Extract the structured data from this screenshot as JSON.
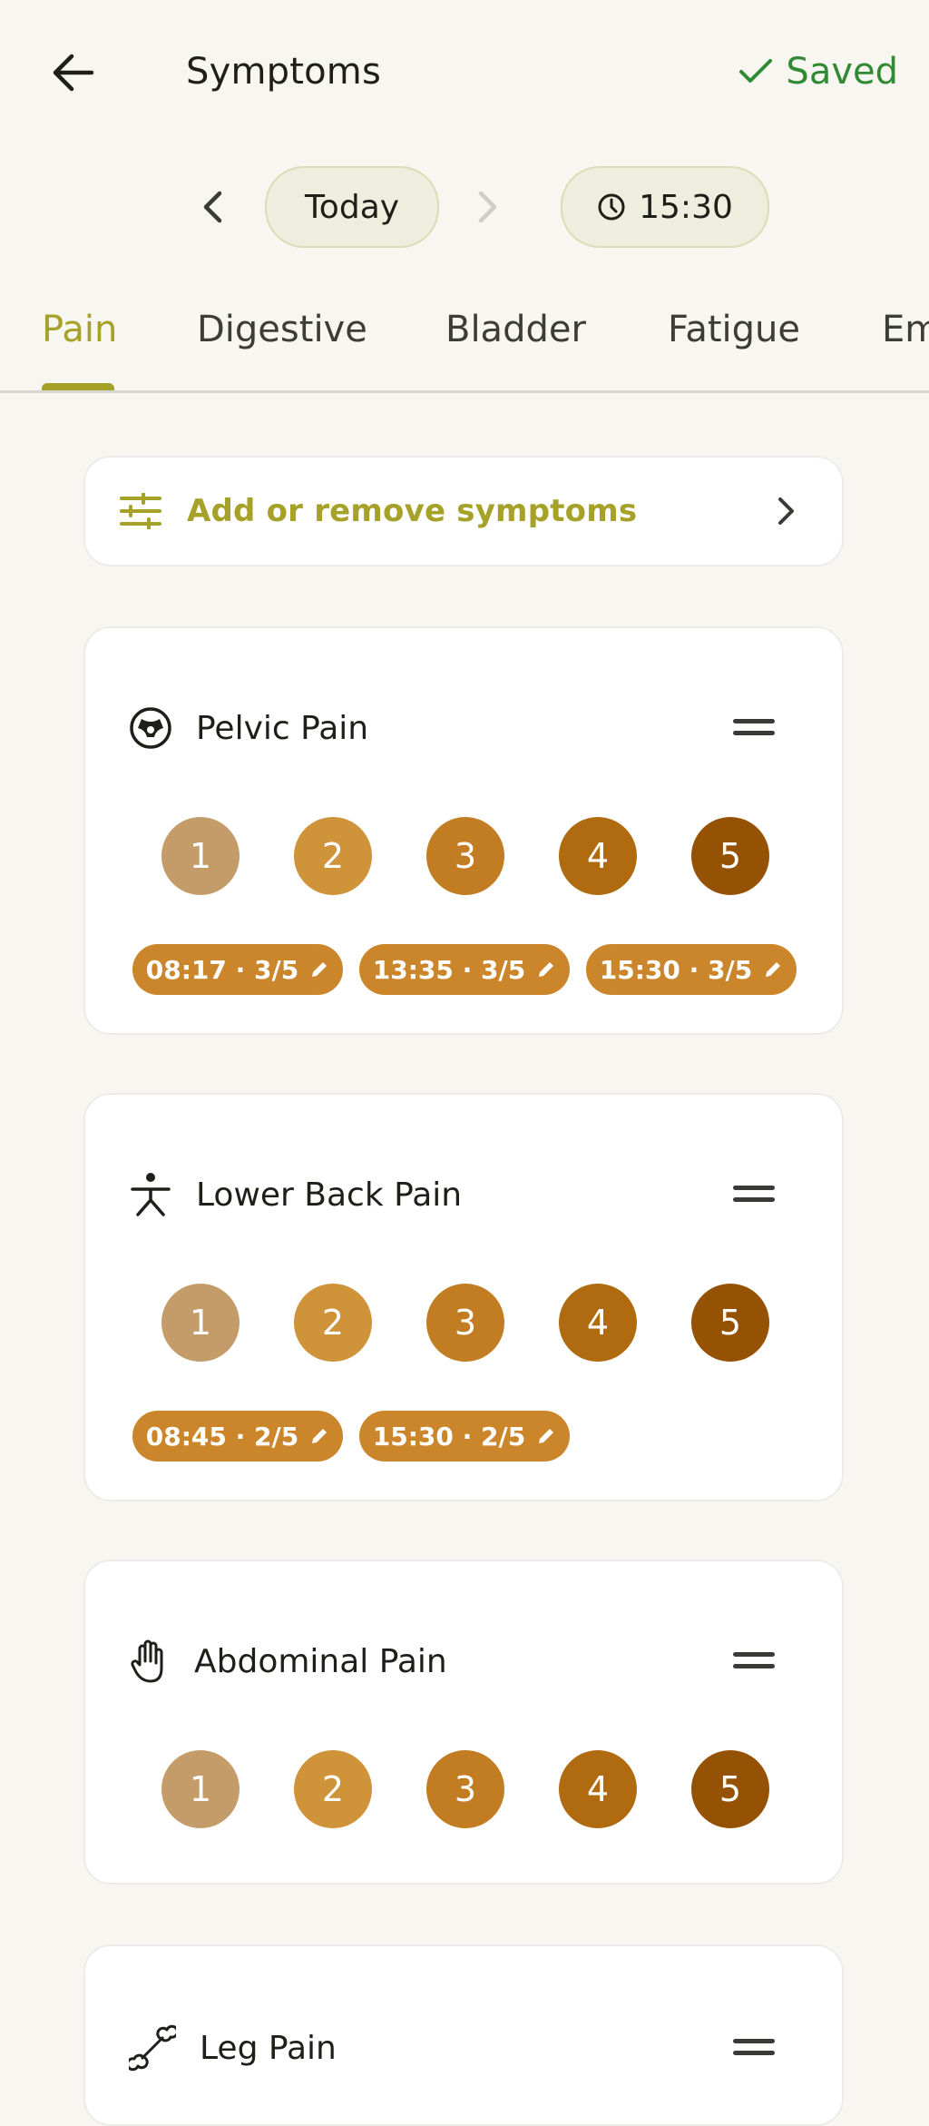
{
  "header": {
    "title": "Symptoms",
    "saved_label": "Saved",
    "colors": {
      "saved": "#2f8a33",
      "accent": "#a5a129"
    }
  },
  "datebar": {
    "date_label": "Today",
    "time_label": "15:30"
  },
  "tabs": [
    {
      "label": "Pain",
      "active": true
    },
    {
      "label": "Digestive",
      "active": false
    },
    {
      "label": "Bladder",
      "active": false
    },
    {
      "label": "Fatigue",
      "active": false
    },
    {
      "label": "Em",
      "active": false
    }
  ],
  "add_symptoms": {
    "label": "Add or remove symptoms",
    "icon": "sliders-icon"
  },
  "rating_scale": [
    "1",
    "2",
    "3",
    "4",
    "5"
  ],
  "symptoms": [
    {
      "name": "Pelvic Pain",
      "icon": "pelvis-icon",
      "entries": [
        "08:17 · 3/5",
        "13:35 · 3/5",
        "15:30 · 3/5"
      ]
    },
    {
      "name": "Lower Back Pain",
      "icon": "person-icon",
      "entries": [
        "08:45 · 2/5",
        "15:30 · 2/5"
      ]
    },
    {
      "name": "Abdominal Pain",
      "icon": "hand-icon",
      "entries": []
    },
    {
      "name": "Leg Pain",
      "icon": "bone-icon",
      "entries": []
    }
  ]
}
